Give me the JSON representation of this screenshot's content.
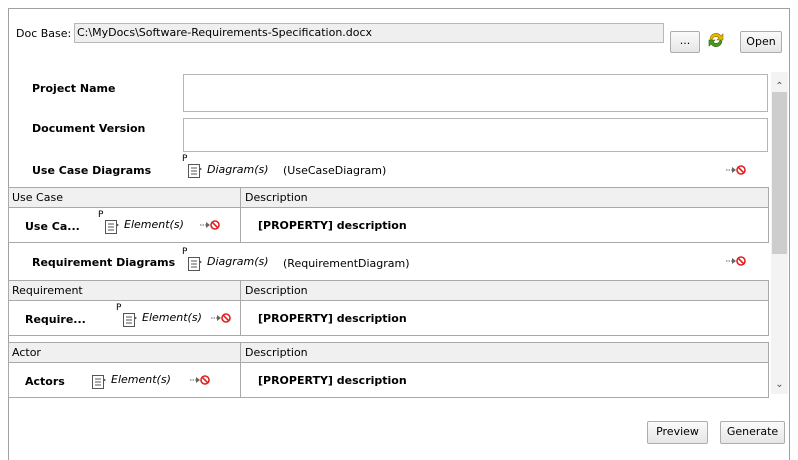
{
  "doc_base": {
    "label": "Doc Base:",
    "path": "C:\\MyDocs\\Software-Requirements-Specification.docx",
    "browse_label": "...",
    "open_label": "Open"
  },
  "fields": {
    "project_name_label": "Project Name",
    "document_version_label": "Document Version",
    "project_name_value": "",
    "document_version_value": ""
  },
  "use_case_diagrams": {
    "title": "Use Case Diagrams",
    "template_marker": "P",
    "diagram_label": "Diagram(s)",
    "diagram_type": "(UseCaseDiagram)",
    "columns": [
      "Use Case",
      "Description"
    ],
    "row": {
      "name": "Use Ca...",
      "element_label": "Element(s)",
      "description": "[PROPERTY] description"
    }
  },
  "requirement_diagrams": {
    "title": "Requirement Diagrams",
    "template_marker": "P",
    "diagram_label": "Diagram(s)",
    "diagram_type": "(RequirementDiagram)",
    "columns": [
      "Requirement",
      "Description"
    ],
    "row": {
      "name": "Require...",
      "element_label": "Element(s)",
      "description": "[PROPERTY] description"
    }
  },
  "actors": {
    "columns": [
      "Actor",
      "Description"
    ],
    "row": {
      "name": "Actors",
      "element_label": "Element(s)",
      "description": "[PROPERTY] description"
    }
  },
  "footer": {
    "preview_label": "Preview",
    "generate_label": "Generate"
  },
  "icons": {
    "refresh": "refresh-icon",
    "template": "element-template-icon",
    "remove": "arrow-remove-icon"
  },
  "colors": {
    "remove_red": "#e02020",
    "refresh_green": "#4a9a1a",
    "refresh_yellow": "#e6b800"
  }
}
